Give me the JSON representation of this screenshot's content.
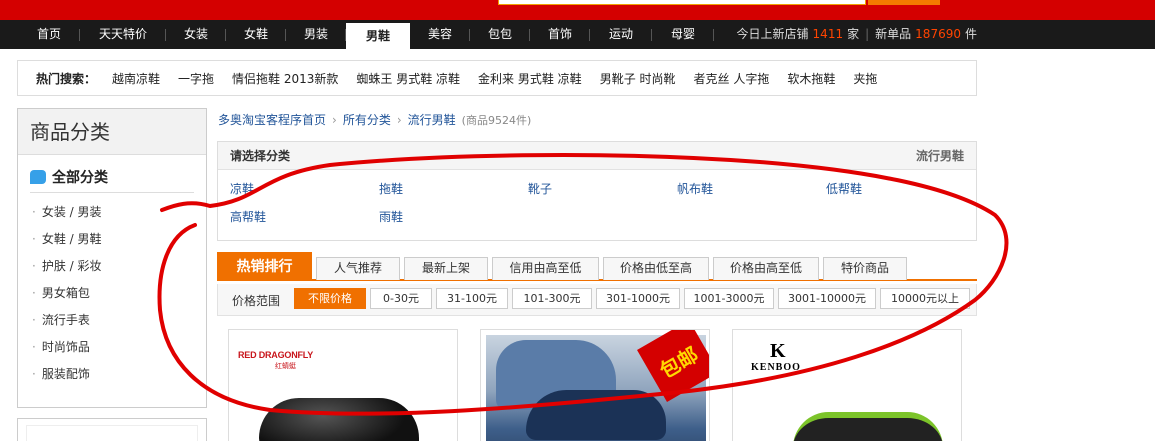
{
  "nav": {
    "items": [
      "首页",
      "天天特价",
      "女装",
      "女鞋",
      "男装",
      "男鞋",
      "美容",
      "包包",
      "首饰",
      "运动",
      "母婴"
    ],
    "active_index": 5,
    "stats": {
      "new_shops_label": "今日上新店铺",
      "new_shops_count": "1411",
      "new_shops_unit": "家",
      "divider": "|",
      "new_items_label": "新单品",
      "new_items_count": "187690",
      "new_items_unit": "件"
    }
  },
  "hot_search": {
    "label": "热门搜索：",
    "links": [
      "越南凉鞋",
      "一字拖",
      "情侣拖鞋 2013新款",
      "蜘蛛王 男式鞋 凉鞋",
      "金利来 男式鞋 凉鞋",
      "男靴子 时尚靴",
      "者克丝 人字拖",
      "软木拖鞋",
      "夹拖"
    ]
  },
  "sidebar": {
    "title": "商品分类",
    "all_label": "全部分类",
    "items": [
      "女装 / 男装",
      "女鞋 / 男鞋",
      "护肤 / 彩妆",
      "男女箱包",
      "流行手表",
      "时尚饰品",
      "服装配饰"
    ]
  },
  "breadcrumb": {
    "home": "多奥淘宝客程序首页",
    "arrow": "›",
    "all": "所有分类",
    "current": "流行男鞋",
    "count": "(商品9524件)"
  },
  "category_box": {
    "title": "请选择分类",
    "current": "流行男鞋",
    "links": [
      "凉鞋",
      "拖鞋",
      "靴子",
      "帆布鞋",
      "低帮鞋",
      "高帮鞋",
      "雨鞋"
    ]
  },
  "sort_tabs": [
    "热销排行",
    "人气推荐",
    "最新上架",
    "信用由高至低",
    "价格由低至高",
    "价格由高至低",
    "特价商品"
  ],
  "price_filter": {
    "label": "价格范围",
    "options": [
      "不限价格",
      "0-30元",
      "31-100元",
      "101-300元",
      "301-1000元",
      "1001-3000元",
      "3001-10000元",
      "10000元以上"
    ]
  },
  "products": [
    {
      "brand": "RED DRAGONFLY",
      "brand_cn": "红蜻蜓"
    },
    {
      "badge": "包邮"
    },
    {
      "brand_logo": "K",
      "brand": "KENBOO"
    }
  ],
  "colors": {
    "top_red": "#d40000",
    "nav_bg": "#1a1a1a",
    "accent_orange": "#f07000",
    "link_blue": "#225599",
    "marker_red": "#e00000"
  }
}
